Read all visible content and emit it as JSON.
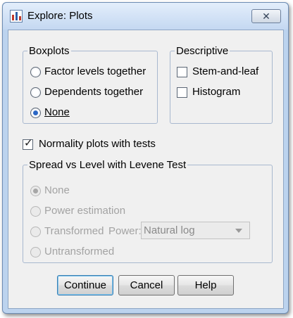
{
  "window": {
    "title": "Explore: Plots",
    "close_symbol": "✕"
  },
  "boxplots": {
    "legend": "Boxplots",
    "options": [
      {
        "label": "Factor levels together",
        "selected": false
      },
      {
        "label": "Dependents together",
        "selected": false
      },
      {
        "label": "None",
        "selected": true
      }
    ]
  },
  "descriptive": {
    "legend": "Descriptive",
    "options": [
      {
        "label": "Stem-and-leaf",
        "checked": false
      },
      {
        "label": "Histogram",
        "checked": false
      }
    ]
  },
  "normality": {
    "label": "Normality plots with tests",
    "checked": true,
    "check_symbol": "✓"
  },
  "spread": {
    "legend": "Spread vs Level with Levene Test",
    "options": [
      {
        "label": "None",
        "selected": true
      },
      {
        "label": "Power estimation",
        "selected": false
      },
      {
        "label": "Transformed",
        "selected": false
      },
      {
        "label": "Untransformed",
        "selected": false
      }
    ],
    "power_label": "Power:",
    "power_value": "Natural log"
  },
  "buttons": {
    "continue": "Continue",
    "cancel": "Cancel",
    "help": "Help"
  }
}
